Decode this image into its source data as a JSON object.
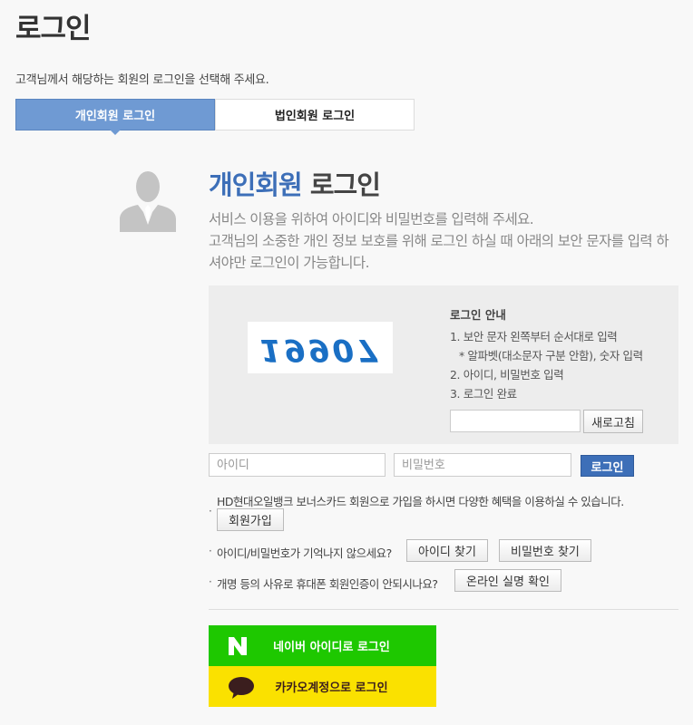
{
  "page": {
    "title": "로그인",
    "intro": "고객님께서 해당하는 회원의 로그인을 선택해 주세요."
  },
  "tabs": [
    {
      "label": "개인회원 로그인",
      "active": true
    },
    {
      "label": "법인회원 로그인",
      "active": false
    }
  ],
  "login": {
    "heading_accent": "개인회원",
    "heading_rest": " 로그인",
    "desc_line1": "서비스 이용을 위하여 아이디와 비밀번호를 입력해 주세요.",
    "desc_line2": "고객님의 소중한 개인 정보 보호를 위해 로그인 하실 때 아래의 보안 문자를 입력 하셔야만 로그인이 가능합니다."
  },
  "captcha": {
    "image_text": "19907",
    "guide_title": "로그인 안내",
    "guide": [
      "1. 보안 문자 왼쪽부터 순서대로 입력",
      "* 알파벳(대소문자 구분 안함), 숫자 입력",
      "2. 아이디, 비밀번호 입력",
      "3. 로그인 완료"
    ],
    "input_value": "",
    "refresh_label": "새로고침"
  },
  "form": {
    "id_placeholder": "아이디",
    "pw_placeholder": "비밀번호",
    "login_label": "로그인"
  },
  "info": {
    "join_text": "HD현대오일뱅크 보너스카드 회원으로 가입을 하시면 다양한 혜택을 이용하실 수 있습니다.",
    "join_btn": "회원가입",
    "forgot_text": "아이디/비밀번호가 기억나지 않으세요?",
    "find_id_btn": "아이디 찾기",
    "find_pw_btn": "비밀번호 찾기",
    "verify_text": "개명 등의 사유로 휴대폰 회원인증이 안되시나요?",
    "verify_btn": "온라인 실명 확인"
  },
  "social": {
    "naver_label": "네이버 아이디로 로그인",
    "kakao_label": "카카오계정으로 로그인"
  },
  "colors": {
    "accent": "#3d6fb8",
    "tab_active": "#6f9ad3",
    "naver": "#1ec800",
    "kakao": "#fae100",
    "captcha_text": "#1a6fc4"
  },
  "icons": [
    "user-silhouette-icon",
    "naver-logo-icon",
    "kakao-bubble-icon"
  ]
}
